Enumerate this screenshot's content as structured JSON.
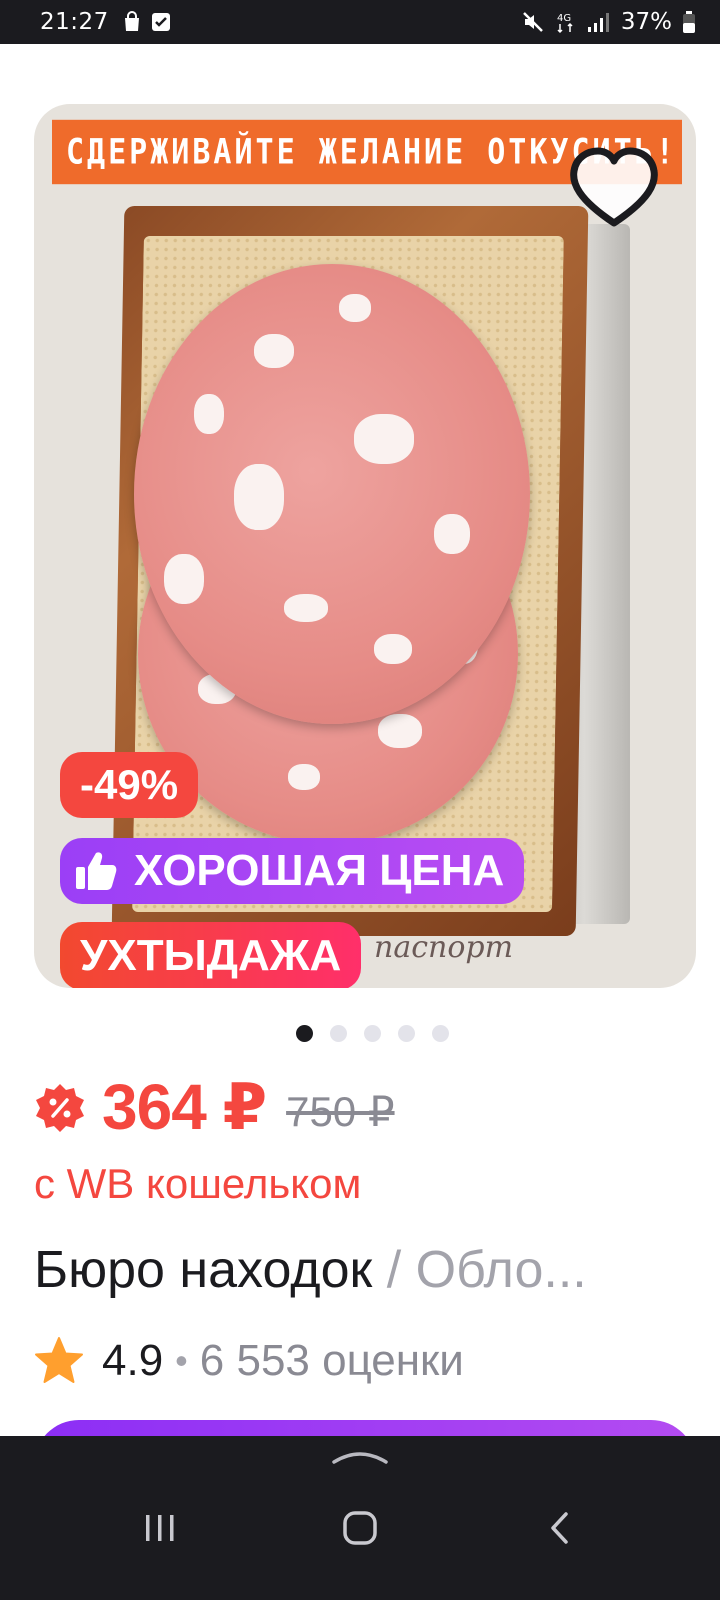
{
  "status_bar": {
    "time": "21:27",
    "network": "4G",
    "battery": "37%"
  },
  "product_image": {
    "banner_text": "СДЕРЖИВАЙТЕ ЖЕЛАНИЕ ОТКУСИТЬ!",
    "cover_text": "паспорт",
    "badges": {
      "discount": "-49%",
      "good_price": "ХОРОШАЯ ЦЕНА",
      "promo": "УХТЫДАЖА"
    },
    "carousel": {
      "count": 5,
      "active": 1
    }
  },
  "price": {
    "current": "364 ₽",
    "old": "750 ₽",
    "wallet_note": "с WB кошельком"
  },
  "title": {
    "brand": "Бюро находок",
    "separator": "/",
    "name": "Обло..."
  },
  "rating": {
    "value": "4.9",
    "separator": "•",
    "reviews": "6 553 оценки"
  },
  "colors": {
    "accent": "#f4473f",
    "purple": "#9b3ff6",
    "dark": "#1b1b1f"
  }
}
